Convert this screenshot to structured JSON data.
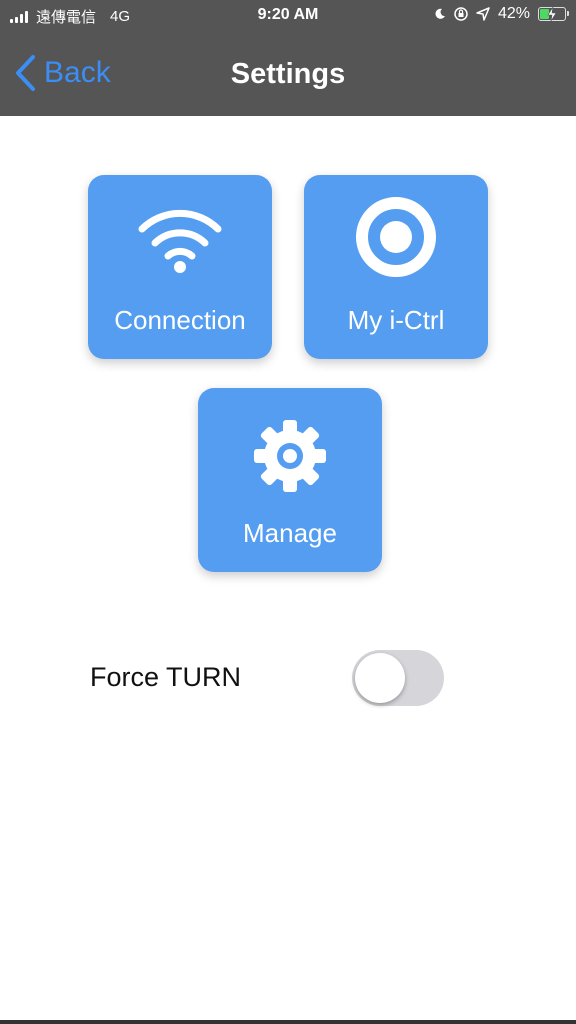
{
  "status_bar": {
    "carrier": "遠傳電信",
    "network": "4G",
    "time": "9:20 AM",
    "battery": "42%",
    "battery_level": 0.42
  },
  "nav": {
    "back_label": "Back",
    "title": "Settings"
  },
  "tiles": [
    {
      "label": "Connection",
      "icon": "wifi-icon"
    },
    {
      "label": "My i-Ctrl",
      "icon": "target-icon"
    },
    {
      "label": "Manage",
      "icon": "gear-icon"
    }
  ],
  "force_turn": {
    "label": "Force TURN",
    "on": false
  },
  "colors": {
    "nav_background": "#555555",
    "tile_blue": "#549df0",
    "back_blue": "#3b8ef5"
  }
}
